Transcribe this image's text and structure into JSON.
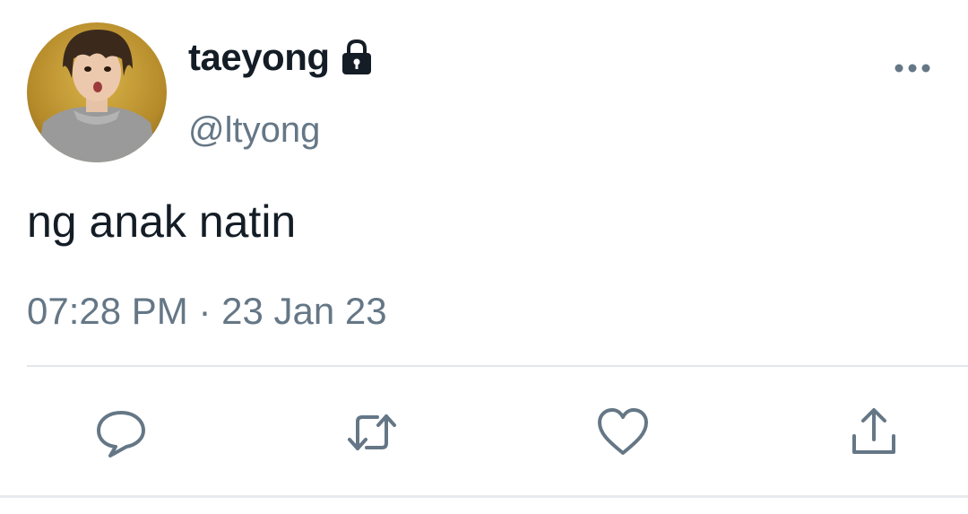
{
  "tweet": {
    "display_name": "taeyong",
    "handle": "@ltyong",
    "text": "ng anak natin",
    "timestamp": "07:28 PM · 23 Jan 23",
    "protected": true
  },
  "icons": {
    "lock": "lock-icon",
    "more": "more-options-icon",
    "reply": "reply-bubble-icon",
    "retweet": "retweet-icon",
    "like": "heart-icon",
    "share": "share-upload-icon"
  },
  "colors": {
    "text_primary": "#141d26",
    "text_secondary": "#657786",
    "icon": "#657786",
    "divider": "#e1e8ed"
  }
}
